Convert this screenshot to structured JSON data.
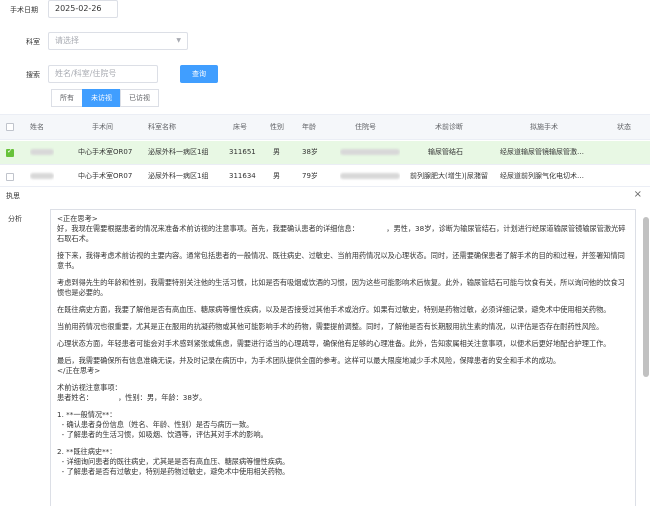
{
  "filters": {
    "date_label": "手术日期",
    "date_value": "2025-02-26",
    "department_label": "科室",
    "department_placeholder": "请选择",
    "search_label": "搜索",
    "search_placeholder": "姓名/科室/住院号",
    "query_button": "查询"
  },
  "tabs": [
    "所有",
    "未访视",
    "已访视"
  ],
  "active_tab": 1,
  "table": {
    "headers": [
      "姓名",
      "手术间",
      "科室名称",
      "床号",
      "性别",
      "年龄",
      "住院号",
      "术前诊断",
      "拟施手术",
      "状态"
    ],
    "rows": [
      {
        "name": "",
        "room": "中心手术室OR07",
        "dept": "泌尿外科一病区1组",
        "bed": "311651",
        "sex": "男",
        "age": "38岁",
        "inpatient_no": "",
        "diagnosis": "输尿管结石",
        "surgery": "经尿道输尿管镜输尿管激…",
        "selected": true
      },
      {
        "name": "",
        "room": "中心手术室OR07",
        "dept": "泌尿外科一病区1组",
        "bed": "311634",
        "sex": "男",
        "age": "79岁",
        "inpatient_no": "",
        "diagnosis": "前列腺肥大(增生)|尿潴留",
        "surgery": "经尿道前列腺气化电切术…",
        "selected": false
      }
    ]
  },
  "panel": {
    "title": "执思",
    "close_icon": "×",
    "analysis_label": "分析",
    "paragraphs": [
      "<正在思考>",
      "好，我现在需要根据患者的情况来准备术前访视的注意事项。首先，我要确认患者的详细信息：            ，男性，38岁，诊断为输尿管结石，计划进行经尿道输尿管镜输尿管激光碎石取石术。",
      "接下来，我得考虑术前访视的主要内容。通常包括患者的一般情况、既往病史、过敏史、当前用药情况以及心理状态。同时，还需要确保患者了解手术的目的和过程，并签署知情同意书。",
      "考虑到得先生的年龄和性别，我需要特别关注他的生活习惯，比如是否有吸烟或饮酒的习惯，因为这些可能影响术后恢复。此外，输尿管结石可能与饮食有关，所以询问他的饮食习惯也是必要的。",
      "在既往病史方面，我要了解他是否有高血压、糖尿病等慢性疾病，以及是否接受过其他手术或治疗。如果有过敏史，特别是药物过敏，必须详细记录，避免术中使用相关药物。",
      "当前用药情况也很重要，尤其是正在服用的抗凝药物或其他可能影响手术的药物，需要提前调整。同时，了解他是否有长期服用抗生素的情况，以评估是否存在耐药性风险。",
      "心理状态方面，年轻患者可能会对手术感到紧张或焦虑，需要进行适当的心理疏导，确保他有足够的心理准备。此外，告知家属相关注意事项，以便术后更好地配合护理工作。",
      "最后，我需要确保所有信息准确无误，并及时记录在病历中，为手术团队提供全面的参考。这样可以最大限度地减少手术风险，保障患者的安全和手术的成功。\n</正在思考>",
      "术前访视注意事项：\n患者姓名：           ，性别：男，年龄：38岁。",
      "1. **一般情况**：\n  - 确认患者身份信息（姓名、年龄、性别）是否与病历一致。\n  - 了解患者的生活习惯，如吸烟、饮酒等，评估其对手术的影响。",
      "2. **既往病史**：\n  - 详细询问患者的既往病史，尤其是是否有高血压、糖尿病等慢性疾病。\n  - 了解患者是否有过敏史，特别是药物过敏史，避免术中使用相关药物。"
    ]
  }
}
